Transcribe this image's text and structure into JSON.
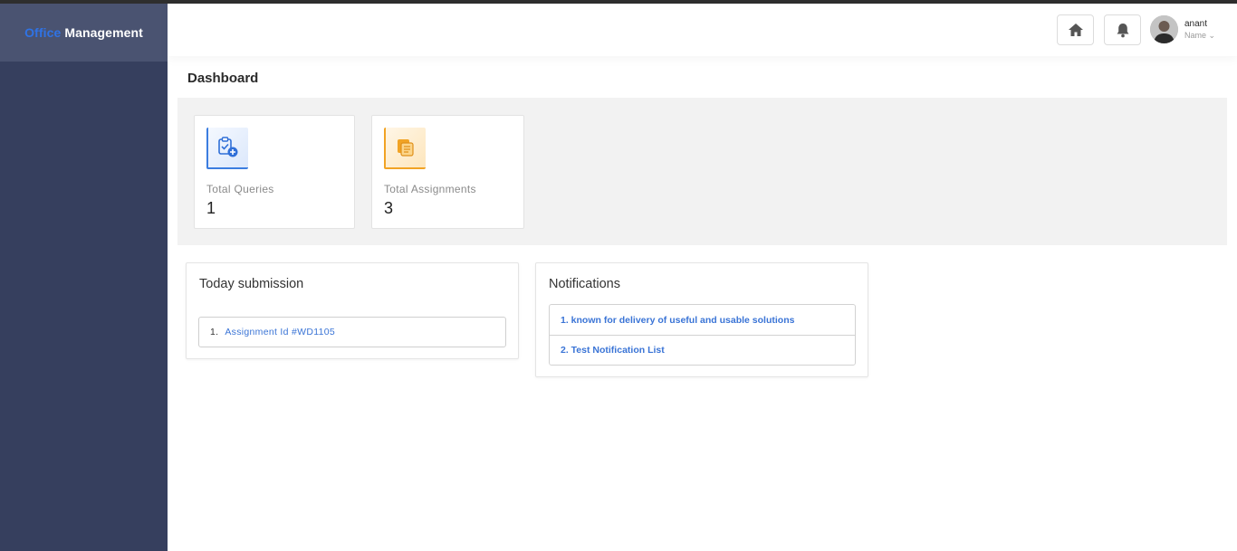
{
  "brand": {
    "part1": "Office",
    "part2": "Management"
  },
  "header": {
    "user": {
      "name": "anant",
      "role": "Name ⌄"
    }
  },
  "page": {
    "title": "Dashboard"
  },
  "stats": [
    {
      "label": "Total Queries",
      "value": "1"
    },
    {
      "label": "Total Assignments",
      "value": "3"
    }
  ],
  "today_submission": {
    "title": "Today submission",
    "items": [
      {
        "num": "1.",
        "label": "Assignment Id #WD1105"
      }
    ]
  },
  "notifications": {
    "title": "Notifications",
    "items": [
      {
        "label": "1. known for delivery of useful and usable solutions"
      },
      {
        "label": "2. Test Notification List"
      }
    ]
  },
  "colors": {
    "sidebar": "#363f5e",
    "brand_bg": "#4a5371",
    "accent_blue": "#3a74d6",
    "accent_orange": "#f1a324"
  }
}
